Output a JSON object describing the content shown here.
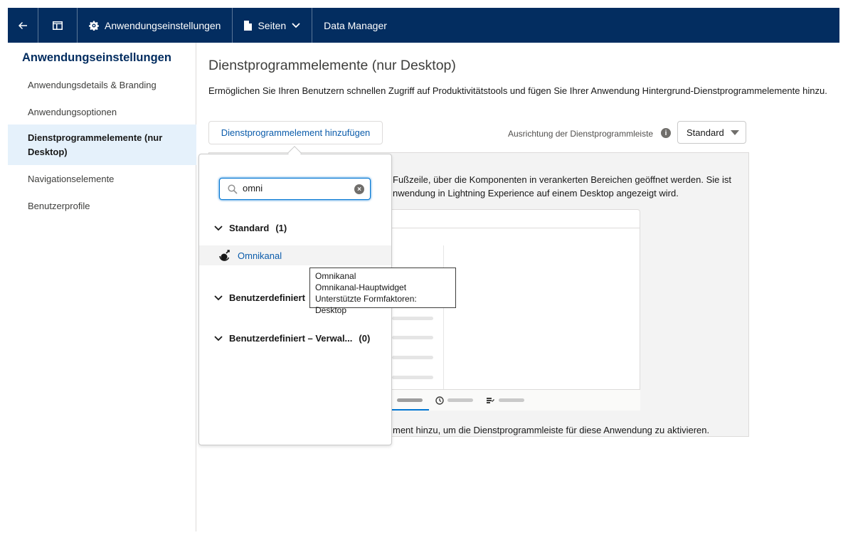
{
  "topbar": {
    "back_icon": "arrow-left-icon",
    "layout_icon": "layout-icon",
    "settings_label": "Anwendungseinstellungen",
    "pages_label": "Seiten",
    "data_manager_label": "Data Manager"
  },
  "sidebar": {
    "title": "Anwendungseinstellungen",
    "items": [
      {
        "label": "Anwendungsdetails & Branding"
      },
      {
        "label": "Anwendungsoptionen"
      },
      {
        "label": "Dienstprogrammelemente (nur Desktop)"
      },
      {
        "label": "Navigationselemente"
      },
      {
        "label": "Benutzerprofile"
      }
    ]
  },
  "main": {
    "title": "Dienstprogrammelemente (nur Desktop)",
    "description": "Ermöglichen Sie Ihren Benutzern schnellen Zugriff auf Produktivitätstools und fügen Sie Ihrer Anwendung Hintergrund-Dienstprogrammelemente hinzu.",
    "add_button": "Dienstprogrammelement hinzufügen",
    "orientation_label": "Ausrichtung der Dienstprogrammleiste",
    "orientation_value": "Standard",
    "panel_text_line1": "Fußzeile, über die Komponenten in verankerten Bereichen geöffnet werden. Sie ist",
    "panel_text_line2": "nwendung in Lightning Experience auf einem Desktop angezeigt wird.",
    "panel_footer": "ment hinzu, um die Dienstprogrammleiste für diese Anwendung zu aktivieren."
  },
  "dropdown": {
    "search_value": "omni",
    "groups": [
      {
        "label": "Standard",
        "count": "(1)"
      },
      {
        "label": "Benutzerdefiniert",
        "count": ""
      },
      {
        "label": "Benutzerdefiniert – Verwal...",
        "count": "(0)"
      }
    ],
    "item_label": "Omnikanal"
  },
  "tooltip": {
    "line1": "Omnikanal",
    "line2": "Omnikanal-Hauptwidget",
    "line3": "Unterstützte Formfaktoren: Desktop"
  }
}
